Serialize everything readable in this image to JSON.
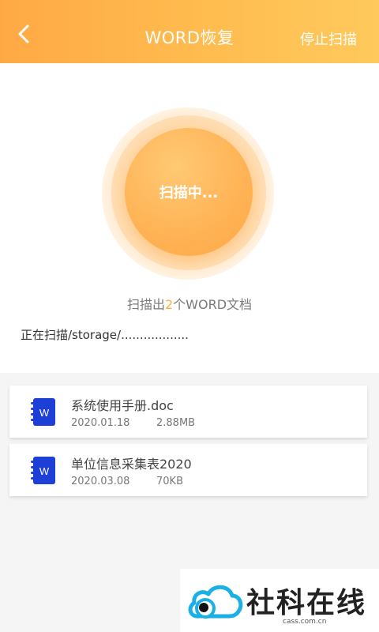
{
  "header": {
    "title": "WORD恢复",
    "stop_label": "停止扫描"
  },
  "scan": {
    "button_label": "扫描中...",
    "count_prefix": "扫描出",
    "count": "2",
    "count_suffix": "个WORD文档",
    "path_text": "正在扫描/storage/.................."
  },
  "files": [
    {
      "icon": "word-doc-icon",
      "icon_letter": "W",
      "name": "系统使用手册.doc",
      "date": "2020.01.18",
      "size": "2.88MB"
    },
    {
      "icon": "word-doc-icon",
      "icon_letter": "W",
      "name": "单位信息采集表2020",
      "date": "2020.03.08",
      "size": "70KB"
    }
  ],
  "watermark": {
    "text": "社科在线",
    "domain": "cass.com.cn"
  },
  "colors": {
    "header_start": "#ffa945",
    "header_end": "#ffc95c",
    "accent": "#ffb13c",
    "word_blue": "#1d3fd6"
  }
}
